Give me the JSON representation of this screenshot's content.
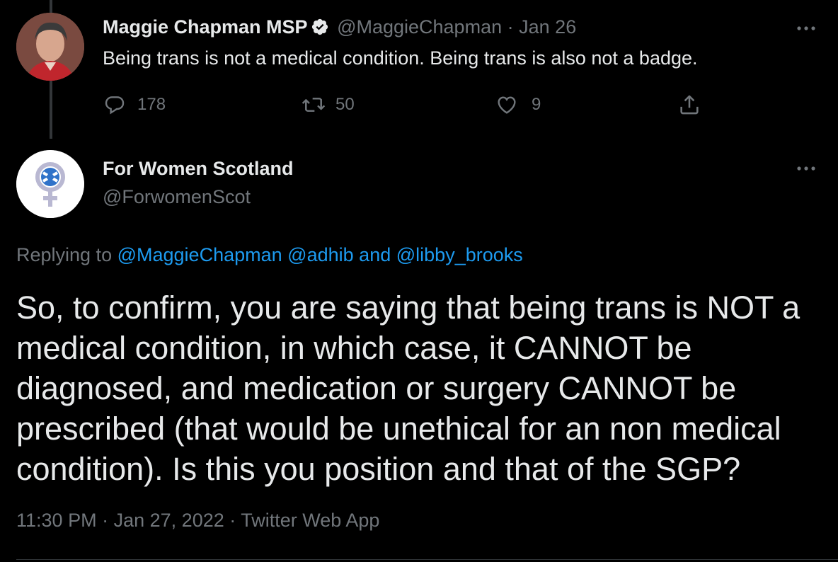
{
  "original_tweet": {
    "author_name": "Maggie Chapman MSP",
    "handle": "@MaggieChapman",
    "separator": "·",
    "date": "Jan 26",
    "text": "Being trans is not a medical condition. Being trans is also not a badge.",
    "actions": {
      "reply_count": "178",
      "retweet_count": "50",
      "like_count": "9"
    },
    "icons": [
      "verified-badge-icon",
      "reply-icon",
      "retweet-icon",
      "like-icon",
      "share-icon",
      "more-icon"
    ]
  },
  "reply_tweet": {
    "author_name": "For Women Scotland",
    "handle": "@ForwomenScot",
    "replying_prefix": "Replying to",
    "replying_mentions": [
      "@MaggieChapman",
      "@adhib"
    ],
    "replying_and": "and",
    "replying_last": "@libby_brooks",
    "text": "So, to confirm, you are saying that being trans is NOT a medical condition, in which case, it CANNOT be diagnosed, and medication or surgery CANNOT be prescribed (that would be unethical for an non medical condition). Is this you position and that of the SGP?",
    "time": "11:30 PM",
    "separator": "·",
    "date": "Jan 27, 2022",
    "source": "Twitter Web App"
  },
  "colors": {
    "background": "#000000",
    "text": "#e7e9ea",
    "muted": "#71767b",
    "link": "#1d9bf0",
    "verified": "#e7e9ea",
    "fws_logo": "#bdbdd6"
  }
}
